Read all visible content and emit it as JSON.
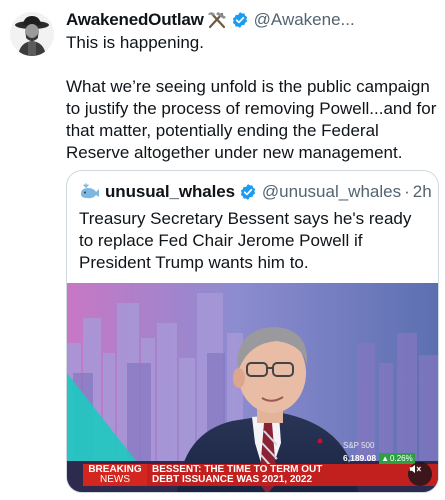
{
  "post": {
    "author_name": "AwakenedOutlaw",
    "author_handle": "@Awakene...",
    "text_line1": "This is happening.",
    "text_para2": "What we’re seeing unfold is the public campaign to justify the process of removing Powell...and for that matter, potentially ending the Federal Reserve altogether under new management."
  },
  "quoted_post": {
    "author_name": "unusual_whales",
    "author_handle": "@unusual_whales",
    "separator": "·",
    "time": "2h",
    "text": "Treasury Secretary Bessent says he's ready to replace Fed Chair Jerome Powell if President Trump wants him to.",
    "media": {
      "ticker_label": "S&P 500",
      "ticker_value": "6,189.08",
      "ticker_change": "0.26%",
      "breaking_line1": "BREAKING",
      "breaking_line2": "NEWS",
      "headline_line1": "BESSENT: THE TIME TO TERM OUT",
      "headline_line2": "DEBT ISSUANCE WAS 2021, 2022"
    }
  },
  "icons": {
    "tools": "hammer-and-pick-icon",
    "verified": "verified-badge-icon",
    "whale": "whale-icon",
    "sound": "muted-speaker-icon",
    "up_arrow": "up-arrow-icon"
  },
  "colors": {
    "verified_blue": "#1d9bf0",
    "secondary_text": "#536471",
    "breaking_red": "#d3261f",
    "ticker_green": "#2ea043"
  }
}
